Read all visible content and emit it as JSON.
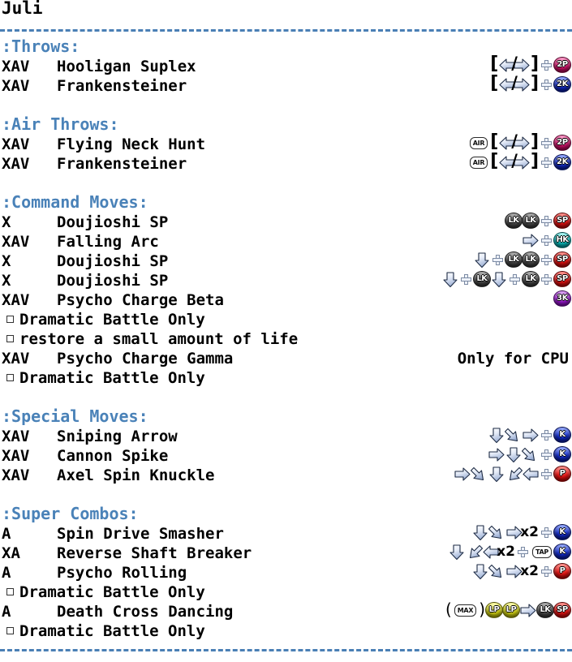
{
  "title": "Juli",
  "colors": {
    "heading": "#4a82b8",
    "rule": "#4a7fb5",
    "text": "#000000"
  },
  "sections": [
    {
      "heading": ":Throws:",
      "entries": [
        {
          "prefix": "XAV",
          "name": "Hooligan Suplex",
          "tokens": [
            {
              "t": "bracket",
              "v": "["
            },
            {
              "t": "arrow",
              "dir": "left"
            },
            {
              "t": "slash",
              "v": "/"
            },
            {
              "t": "arrow",
              "dir": "right"
            },
            {
              "t": "bracket",
              "v": "]"
            },
            {
              "t": "plus"
            },
            {
              "t": "button",
              "label": "2P",
              "color": "magenta"
            }
          ]
        },
        {
          "prefix": "XAV",
          "name": "Frankensteiner",
          "tokens": [
            {
              "t": "bracket",
              "v": "["
            },
            {
              "t": "arrow",
              "dir": "left"
            },
            {
              "t": "slash",
              "v": "/"
            },
            {
              "t": "arrow",
              "dir": "right"
            },
            {
              "t": "bracket",
              "v": "]"
            },
            {
              "t": "plus"
            },
            {
              "t": "button",
              "label": "2K",
              "color": "blue"
            }
          ]
        }
      ]
    },
    {
      "heading": ":Air Throws:",
      "entries": [
        {
          "prefix": "XAV",
          "name": "Flying Neck Hunt",
          "tokens": [
            {
              "t": "tag",
              "v": "AIR"
            },
            {
              "t": "bracket",
              "v": "["
            },
            {
              "t": "arrow",
              "dir": "left"
            },
            {
              "t": "slash",
              "v": "/"
            },
            {
              "t": "arrow",
              "dir": "right"
            },
            {
              "t": "bracket",
              "v": "]"
            },
            {
              "t": "plus"
            },
            {
              "t": "button",
              "label": "2P",
              "color": "magenta"
            }
          ]
        },
        {
          "prefix": "XAV",
          "name": "Frankensteiner",
          "tokens": [
            {
              "t": "tag",
              "v": "AIR"
            },
            {
              "t": "bracket",
              "v": "["
            },
            {
              "t": "arrow",
              "dir": "left"
            },
            {
              "t": "slash",
              "v": "/"
            },
            {
              "t": "arrow",
              "dir": "right"
            },
            {
              "t": "bracket",
              "v": "]"
            },
            {
              "t": "plus"
            },
            {
              "t": "button",
              "label": "2K",
              "color": "blue"
            }
          ]
        }
      ]
    },
    {
      "heading": ":Command Moves:",
      "entries": [
        {
          "prefix": "X",
          "name": "Doujioshi SP",
          "tokens": [
            {
              "t": "button",
              "label": "LK",
              "color": "grey"
            },
            {
              "t": "button",
              "label": "LK",
              "color": "grey"
            },
            {
              "t": "plus"
            },
            {
              "t": "button",
              "label": "SP",
              "color": "red"
            }
          ]
        },
        {
          "prefix": "XAV",
          "name": "Falling Arc",
          "tokens": [
            {
              "t": "arrow",
              "dir": "right"
            },
            {
              "t": "plus"
            },
            {
              "t": "button",
              "label": "HK",
              "color": "cyan"
            }
          ]
        },
        {
          "prefix": "X",
          "name": "Doujioshi SP",
          "tokens": [
            {
              "t": "arrow",
              "dir": "down"
            },
            {
              "t": "plus"
            },
            {
              "t": "button",
              "label": "LK",
              "color": "grey"
            },
            {
              "t": "button",
              "label": "LK",
              "color": "grey"
            },
            {
              "t": "plus"
            },
            {
              "t": "button",
              "label": "SP",
              "color": "red"
            }
          ]
        },
        {
          "prefix": "X",
          "name": "Doujioshi SP",
          "tokens": [
            {
              "t": "arrow",
              "dir": "down"
            },
            {
              "t": "plus"
            },
            {
              "t": "button",
              "label": "LK",
              "color": "grey"
            },
            {
              "t": "arrow",
              "dir": "down"
            },
            {
              "t": "plus"
            },
            {
              "t": "button",
              "label": "LK",
              "color": "grey"
            },
            {
              "t": "plus"
            },
            {
              "t": "button",
              "label": "SP",
              "color": "red"
            }
          ]
        },
        {
          "prefix": "XAV",
          "name": "Psycho Charge Beta",
          "tokens": [
            {
              "t": "button",
              "label": "3K",
              "color": "purple"
            }
          ]
        },
        {
          "note": "Dramatic Battle Only"
        },
        {
          "note": "restore a small amount of life"
        },
        {
          "prefix": "XAV",
          "name": "Psycho Charge Gamma",
          "sidenote": "Only for CPU",
          "tokens": []
        },
        {
          "note": "Dramatic Battle Only"
        }
      ]
    },
    {
      "heading": ":Special Moves:",
      "entries": [
        {
          "prefix": "XAV",
          "name": "Sniping Arrow",
          "tokens": [
            {
              "t": "arrow",
              "dir": "down"
            },
            {
              "t": "arrow",
              "dir": "downright"
            },
            {
              "t": "arrow",
              "dir": "right"
            },
            {
              "t": "plus"
            },
            {
              "t": "button",
              "label": "K",
              "color": "blue"
            }
          ]
        },
        {
          "prefix": "XAV",
          "name": "Cannon Spike",
          "tokens": [
            {
              "t": "arrow",
              "dir": "right"
            },
            {
              "t": "arrow",
              "dir": "down"
            },
            {
              "t": "arrow",
              "dir": "downright"
            },
            {
              "t": "plus"
            },
            {
              "t": "button",
              "label": "K",
              "color": "blue"
            }
          ]
        },
        {
          "prefix": "XAV",
          "name": "Axel Spin Knuckle",
          "tokens": [
            {
              "t": "arrow",
              "dir": "right"
            },
            {
              "t": "arrow",
              "dir": "downright"
            },
            {
              "t": "arrow",
              "dir": "down"
            },
            {
              "t": "arrow",
              "dir": "downleft"
            },
            {
              "t": "arrow",
              "dir": "left"
            },
            {
              "t": "plus"
            },
            {
              "t": "button",
              "label": "P",
              "color": "red"
            }
          ]
        }
      ]
    },
    {
      "heading": ":Super Combos:",
      "entries": [
        {
          "prefix": "A",
          "name": "Spin Drive Smasher",
          "tokens": [
            {
              "t": "arrow",
              "dir": "down"
            },
            {
              "t": "arrow",
              "dir": "downright"
            },
            {
              "t": "arrow",
              "dir": "right"
            },
            {
              "t": "x2",
              "v": "x2"
            },
            {
              "t": "plus"
            },
            {
              "t": "button",
              "label": "K",
              "color": "blue"
            }
          ]
        },
        {
          "prefix": "XA",
          "name": "Reverse Shaft Breaker",
          "tokens": [
            {
              "t": "arrow",
              "dir": "down"
            },
            {
              "t": "arrow",
              "dir": "downleft"
            },
            {
              "t": "arrow",
              "dir": "left"
            },
            {
              "t": "x2",
              "v": "x2"
            },
            {
              "t": "plus"
            },
            {
              "t": "tag",
              "v": "TAP"
            },
            {
              "t": "button",
              "label": "K",
              "color": "blue"
            }
          ]
        },
        {
          "prefix": "A",
          "name": "Psycho Rolling",
          "tokens": [
            {
              "t": "arrow",
              "dir": "down"
            },
            {
              "t": "arrow",
              "dir": "downright"
            },
            {
              "t": "arrow",
              "dir": "right"
            },
            {
              "t": "x2",
              "v": "x2"
            },
            {
              "t": "plus"
            },
            {
              "t": "button",
              "label": "P",
              "color": "red"
            }
          ]
        },
        {
          "note": "Dramatic Battle Only"
        },
        {
          "prefix": "A",
          "name": "Death Cross Dancing",
          "tokens": [
            {
              "t": "paren",
              "v": "("
            },
            {
              "t": "tag",
              "v": "MAX"
            },
            {
              "t": "paren",
              "v": ")"
            },
            {
              "t": "button",
              "label": "LP",
              "color": "yellow"
            },
            {
              "t": "button",
              "label": "LP",
              "color": "yellow"
            },
            {
              "t": "arrow",
              "dir": "right"
            },
            {
              "t": "button",
              "label": "LK",
              "color": "grey"
            },
            {
              "t": "button",
              "label": "SP",
              "color": "red"
            }
          ]
        },
        {
          "note": "Dramatic Battle Only"
        }
      ]
    }
  ]
}
